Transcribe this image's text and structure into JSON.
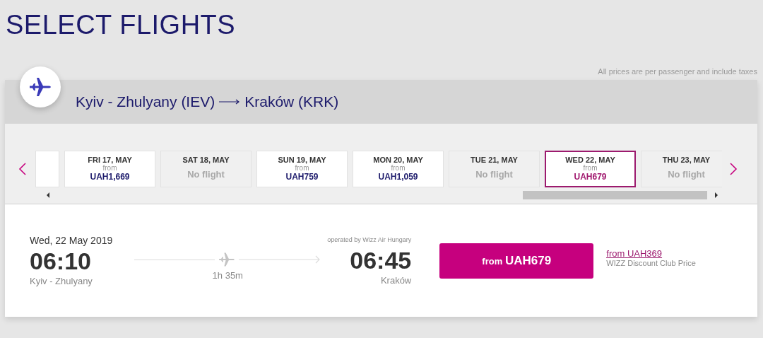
{
  "page_title": "SELECT FLIGHTS",
  "price_note": "All prices are per passenger and include taxes",
  "route": {
    "origin": "Kyiv - Zhulyany (IEV)",
    "destination": "Kraków (KRK)"
  },
  "dates": [
    {
      "kind": "priced",
      "day": "FRI 17, MAY",
      "from_label": "from",
      "price": "UAH1,669",
      "selected": false
    },
    {
      "kind": "none",
      "day": "SAT 18, MAY",
      "status": "No flight",
      "selected": false
    },
    {
      "kind": "priced",
      "day": "SUN 19, MAY",
      "from_label": "from",
      "price": "UAH759",
      "selected": false
    },
    {
      "kind": "priced",
      "day": "MON 20, MAY",
      "from_label": "from",
      "price": "UAH1,059",
      "selected": false
    },
    {
      "kind": "none",
      "day": "TUE 21, MAY",
      "status": "No flight",
      "selected": false
    },
    {
      "kind": "priced",
      "day": "WED 22, MAY",
      "from_label": "from",
      "price": "UAH679",
      "selected": true
    },
    {
      "kind": "none",
      "day": "THU 23, MAY",
      "status": "No flight",
      "selected": false
    }
  ],
  "flight": {
    "date": "Wed, 22 May 2019",
    "departure_time": "06:10",
    "departure_city": "Kyiv - Zhulyany",
    "duration": "1h 35m",
    "operator": "operated by Wizz Air Hungary",
    "arrival_time": "06:45",
    "arrival_city": "Kraków",
    "fare_button": {
      "prefix": "from",
      "price": "UAH679"
    },
    "club_link": {
      "prefix": "from",
      "price": "UAH369"
    },
    "club_label": "WIZZ Discount Club Price"
  }
}
